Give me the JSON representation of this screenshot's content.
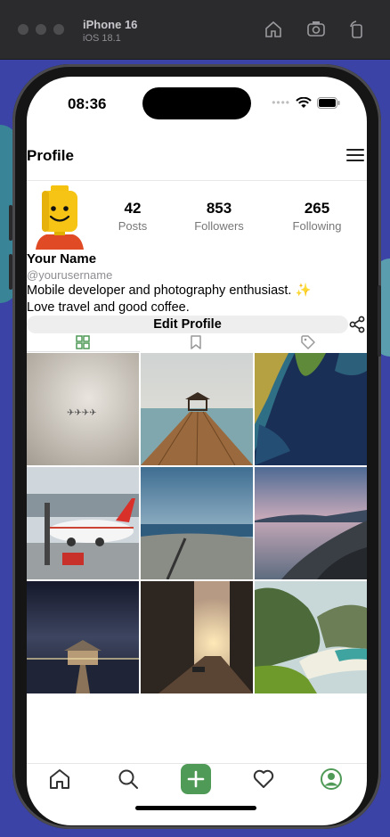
{
  "simulator": {
    "device": "iPhone 16",
    "os": "iOS 18.1"
  },
  "status": {
    "time": "08:36"
  },
  "header": {
    "title": "Profile"
  },
  "profile": {
    "name": "Your Name",
    "username": "@yourusername",
    "bio_line1": "Mobile developer and photography enthusiast. ✨",
    "bio_line2": "Love travel and good coffee.",
    "edit_label": "Edit Profile"
  },
  "stats": [
    {
      "value": "42",
      "label": "Posts"
    },
    {
      "value": "853",
      "label": "Followers"
    },
    {
      "value": "265",
      "label": "Following"
    }
  ],
  "tabs": [
    "grid-icon",
    "bookmark-icon",
    "tag-icon"
  ],
  "active_tab": "grid",
  "photos": [
    "birds-in-fog",
    "wooden-pier-gazebo",
    "aerial-coast",
    "airplane-airport",
    "beach-shore",
    "rocky-coast-sunset",
    "boathouse-night",
    "sunset-city-street",
    "green-valley-beach"
  ],
  "bottom_nav": [
    "home-icon",
    "search-icon",
    "add-icon",
    "heart-icon",
    "profile-icon"
  ],
  "colors": {
    "accent": "#4f9a57",
    "bg": "#ffffff",
    "muted": "#8e8e93"
  }
}
